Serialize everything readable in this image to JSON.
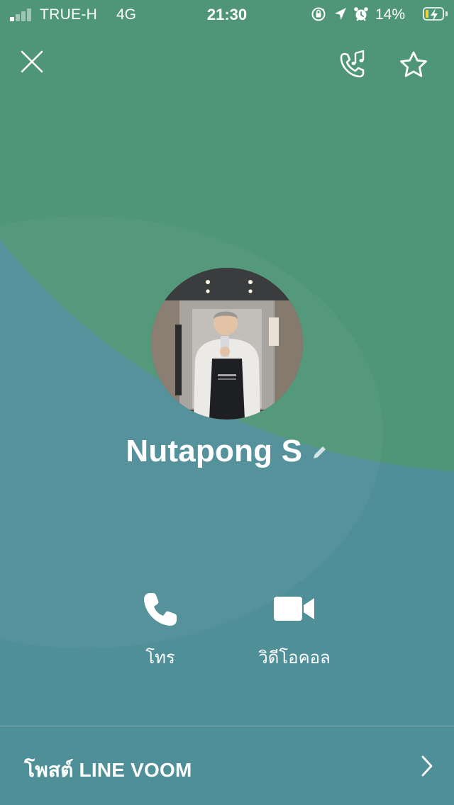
{
  "status_bar": {
    "carrier": "TRUE-H",
    "network": "4G",
    "time": "21:30",
    "battery_percent": "14%",
    "signal_bars_active": 1,
    "signal_bars_total": 4,
    "battery_level": 0.14,
    "battery_color": "#f3d232",
    "icons": [
      "orientation-lock-icon",
      "location-arrow-icon",
      "alarm-icon",
      "battery-charging-icon"
    ]
  },
  "header": {
    "close_icon": "close-icon",
    "ringback_icon": "phone-music-icon",
    "favorite_icon": "star-outline-icon"
  },
  "profile": {
    "display_name": "Nutapong S",
    "edit_icon": "pencil-icon",
    "avatar": "profile-photo"
  },
  "actions": {
    "call_label": "โทร",
    "call_icon": "phone-icon",
    "video_label": "วิดีโอคอล",
    "video_icon": "video-camera-icon"
  },
  "footer": {
    "voom_label": "โพสต์ LINE VOOM",
    "chevron_icon": "chevron-right-icon"
  },
  "colors": {
    "background_top": "#4f9679",
    "background_bottom": "#4f8f98",
    "text": "#ffffff"
  }
}
